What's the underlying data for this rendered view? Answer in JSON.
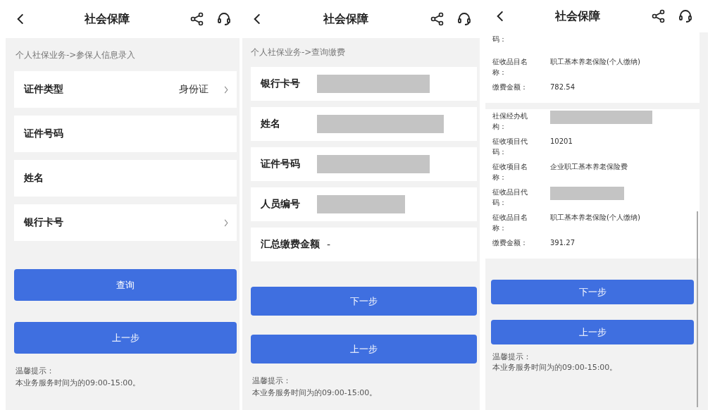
{
  "screens": [
    {
      "kind": "form",
      "title": "社会保障",
      "breadcrumb": "个人社保业务->参保人信息录入",
      "fields": [
        {
          "label": "证件类型",
          "value": "身份证",
          "chevron": true
        },
        {
          "label": "证件号码",
          "chevron": false
        },
        {
          "label": "姓名",
          "chevron": false
        },
        {
          "label": "银行卡号",
          "chevron": true
        }
      ],
      "buttons": [
        "查询",
        "上一步"
      ],
      "tip_title": "温馨提示：",
      "tip_text": "本业务服务时间为的09:00-15:00。"
    },
    {
      "kind": "result",
      "title": "社会保障",
      "breadcrumb": "个人社保业务->查询缴费",
      "fields": [
        {
          "label": "银行卡号",
          "redacted": true
        },
        {
          "label": "姓名",
          "redacted": true
        },
        {
          "label": "证件号码",
          "redacted": true
        },
        {
          "label": "人员编号",
          "redacted": true
        },
        {
          "label": "汇总缴费金额",
          "value": "-"
        }
      ],
      "buttons": [
        "下一步",
        "上一步"
      ],
      "tip_title": "温馨提示：",
      "tip_text": "本业务服务时间为的09:00-15:00。"
    },
    {
      "kind": "records",
      "title": "社会保障",
      "groups": [
        {
          "items": [
            {
              "label": "码："
            },
            {
              "label": "征收品目名称：",
              "value": "职工基本养老保险(个人缴纳)"
            },
            {
              "label": "缴费金额：",
              "value": "782.54"
            }
          ]
        },
        {
          "items": [
            {
              "label": "社保经办机构：",
              "redacted": true
            },
            {
              "label": "征收项目代码：",
              "value": "10201"
            },
            {
              "label": "征收项目名称：",
              "value": "企业职工基本养老保险费"
            },
            {
              "label": "征收品目代码：",
              "redacted": true
            },
            {
              "label": "征收品目名称：",
              "value": "职工基本养老保险(个人缴纳)"
            },
            {
              "label": "缴费金额：",
              "value": "391.27"
            }
          ]
        }
      ],
      "buttons": [
        "下一步",
        "上一步"
      ],
      "tip_title": "温馨提示：",
      "tip_text": "本业务服务时间为的09:00-15:00。"
    }
  ]
}
